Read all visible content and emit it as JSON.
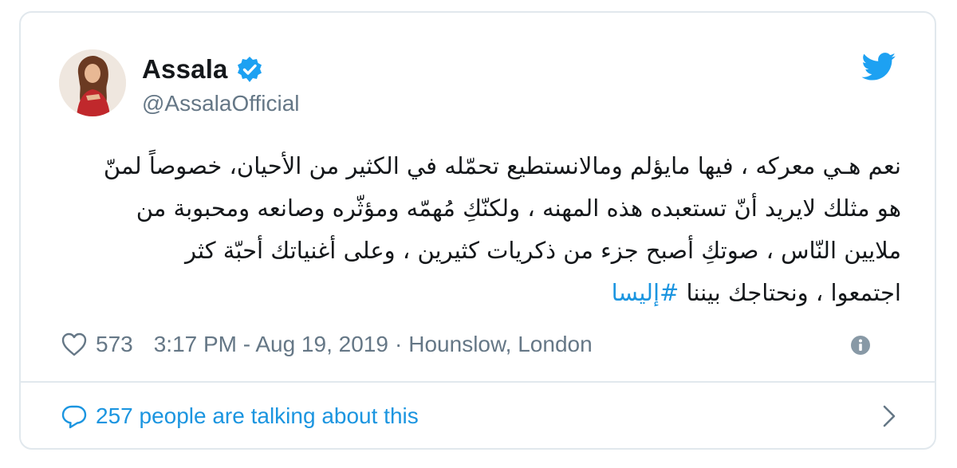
{
  "tweet": {
    "author": {
      "display_name": "Assala",
      "handle": "@AssalaOfficial",
      "verified": true
    },
    "text_lines": [
      "نعم هـي معركه ، فيها مايؤلم ومالانستطيع تحمّله في الكثير من الأحيان، خصوصاً لمنّ",
      "هو مثلك لايريد أنّ تستعبده هذه المهنه ، ولكنّكِ مُهمّه ومؤثّره وصانعه ومحبوبة من",
      "ملايين النّاس ، صوتكِ أصبح جزء من ذكريات كثيرين ، وعلى أغنياتك أحبّة كثر",
      "اجتمعوا ، ونحتاجك بيننا"
    ],
    "hashtag": "#إليسا",
    "like_count": "573",
    "timestamp": "3:17 PM - Aug 19, 2019",
    "separator": "·",
    "location": "Hounslow, London",
    "conversation_label": "257 people are talking about this"
  },
  "icons": {
    "brand": "twitter-bird",
    "verified": "verified-badge",
    "like": "heart-outline",
    "info": "info-circle",
    "reply": "speech-bubble",
    "next": "chevron-right"
  },
  "colors": {
    "brand_blue": "#1da1f2",
    "link_blue": "#1b95e0",
    "text": "#14171a",
    "muted": "#657786",
    "border": "#e1e8ed"
  }
}
